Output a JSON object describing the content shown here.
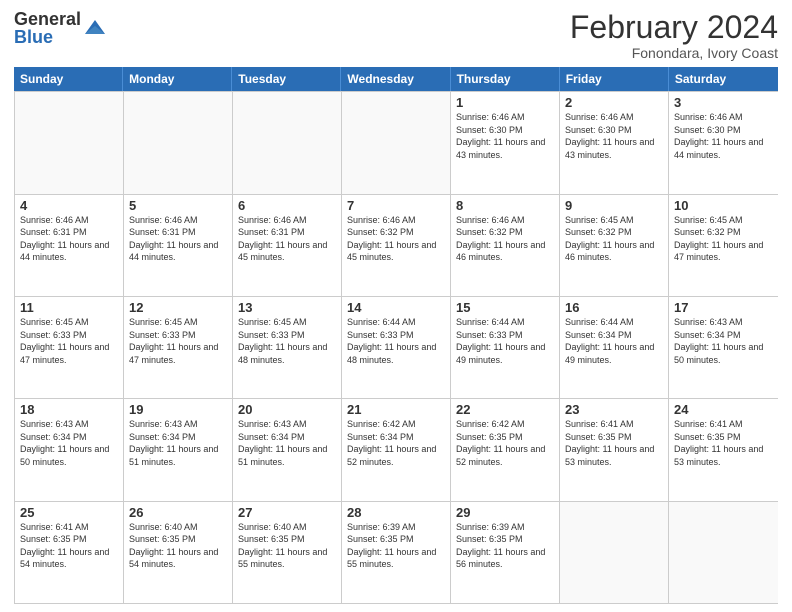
{
  "logo": {
    "general": "General",
    "blue": "Blue"
  },
  "header": {
    "title": "February 2024",
    "subtitle": "Fonondara, Ivory Coast"
  },
  "weekdays": [
    "Sunday",
    "Monday",
    "Tuesday",
    "Wednesday",
    "Thursday",
    "Friday",
    "Saturday"
  ],
  "weeks": [
    [
      {
        "day": "",
        "empty": true
      },
      {
        "day": "",
        "empty": true
      },
      {
        "day": "",
        "empty": true
      },
      {
        "day": "",
        "empty": true
      },
      {
        "day": "1",
        "sunrise": "6:46 AM",
        "sunset": "6:30 PM",
        "daylight": "11 hours and 43 minutes."
      },
      {
        "day": "2",
        "sunrise": "6:46 AM",
        "sunset": "6:30 PM",
        "daylight": "11 hours and 43 minutes."
      },
      {
        "day": "3",
        "sunrise": "6:46 AM",
        "sunset": "6:30 PM",
        "daylight": "11 hours and 44 minutes."
      }
    ],
    [
      {
        "day": "4",
        "sunrise": "6:46 AM",
        "sunset": "6:31 PM",
        "daylight": "11 hours and 44 minutes."
      },
      {
        "day": "5",
        "sunrise": "6:46 AM",
        "sunset": "6:31 PM",
        "daylight": "11 hours and 44 minutes."
      },
      {
        "day": "6",
        "sunrise": "6:46 AM",
        "sunset": "6:31 PM",
        "daylight": "11 hours and 45 minutes."
      },
      {
        "day": "7",
        "sunrise": "6:46 AM",
        "sunset": "6:32 PM",
        "daylight": "11 hours and 45 minutes."
      },
      {
        "day": "8",
        "sunrise": "6:46 AM",
        "sunset": "6:32 PM",
        "daylight": "11 hours and 46 minutes."
      },
      {
        "day": "9",
        "sunrise": "6:45 AM",
        "sunset": "6:32 PM",
        "daylight": "11 hours and 46 minutes."
      },
      {
        "day": "10",
        "sunrise": "6:45 AM",
        "sunset": "6:32 PM",
        "daylight": "11 hours and 47 minutes."
      }
    ],
    [
      {
        "day": "11",
        "sunrise": "6:45 AM",
        "sunset": "6:33 PM",
        "daylight": "11 hours and 47 minutes."
      },
      {
        "day": "12",
        "sunrise": "6:45 AM",
        "sunset": "6:33 PM",
        "daylight": "11 hours and 47 minutes."
      },
      {
        "day": "13",
        "sunrise": "6:45 AM",
        "sunset": "6:33 PM",
        "daylight": "11 hours and 48 minutes."
      },
      {
        "day": "14",
        "sunrise": "6:44 AM",
        "sunset": "6:33 PM",
        "daylight": "11 hours and 48 minutes."
      },
      {
        "day": "15",
        "sunrise": "6:44 AM",
        "sunset": "6:33 PM",
        "daylight": "11 hours and 49 minutes."
      },
      {
        "day": "16",
        "sunrise": "6:44 AM",
        "sunset": "6:34 PM",
        "daylight": "11 hours and 49 minutes."
      },
      {
        "day": "17",
        "sunrise": "6:43 AM",
        "sunset": "6:34 PM",
        "daylight": "11 hours and 50 minutes."
      }
    ],
    [
      {
        "day": "18",
        "sunrise": "6:43 AM",
        "sunset": "6:34 PM",
        "daylight": "11 hours and 50 minutes."
      },
      {
        "day": "19",
        "sunrise": "6:43 AM",
        "sunset": "6:34 PM",
        "daylight": "11 hours and 51 minutes."
      },
      {
        "day": "20",
        "sunrise": "6:43 AM",
        "sunset": "6:34 PM",
        "daylight": "11 hours and 51 minutes."
      },
      {
        "day": "21",
        "sunrise": "6:42 AM",
        "sunset": "6:34 PM",
        "daylight": "11 hours and 52 minutes."
      },
      {
        "day": "22",
        "sunrise": "6:42 AM",
        "sunset": "6:35 PM",
        "daylight": "11 hours and 52 minutes."
      },
      {
        "day": "23",
        "sunrise": "6:41 AM",
        "sunset": "6:35 PM",
        "daylight": "11 hours and 53 minutes."
      },
      {
        "day": "24",
        "sunrise": "6:41 AM",
        "sunset": "6:35 PM",
        "daylight": "11 hours and 53 minutes."
      }
    ],
    [
      {
        "day": "25",
        "sunrise": "6:41 AM",
        "sunset": "6:35 PM",
        "daylight": "11 hours and 54 minutes."
      },
      {
        "day": "26",
        "sunrise": "6:40 AM",
        "sunset": "6:35 PM",
        "daylight": "11 hours and 54 minutes."
      },
      {
        "day": "27",
        "sunrise": "6:40 AM",
        "sunset": "6:35 PM",
        "daylight": "11 hours and 55 minutes."
      },
      {
        "day": "28",
        "sunrise": "6:39 AM",
        "sunset": "6:35 PM",
        "daylight": "11 hours and 55 minutes."
      },
      {
        "day": "29",
        "sunrise": "6:39 AM",
        "sunset": "6:35 PM",
        "daylight": "11 hours and 56 minutes."
      },
      {
        "day": "",
        "empty": true
      },
      {
        "day": "",
        "empty": true
      }
    ]
  ]
}
